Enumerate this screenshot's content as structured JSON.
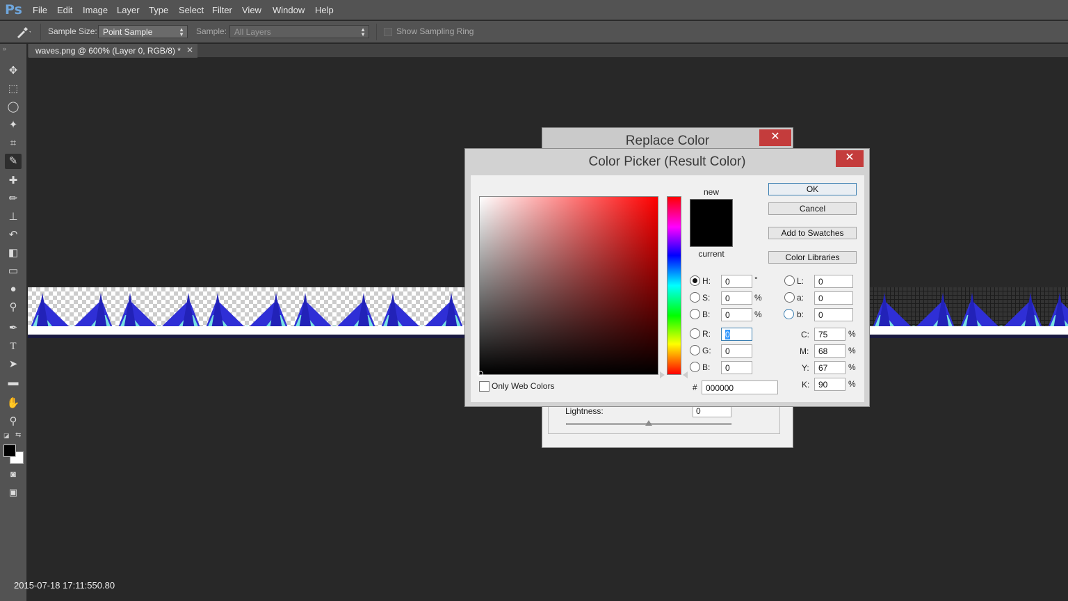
{
  "app": {
    "logo": "Ps"
  },
  "menu": [
    "File",
    "Edit",
    "Image",
    "Layer",
    "Type",
    "Select",
    "Filter",
    "View",
    "Window",
    "Help"
  ],
  "options": {
    "sample_size_label": "Sample Size:",
    "sample_size_value": "Point Sample",
    "sample_label": "Sample:",
    "sample_value": "All Layers",
    "sampling_ring_label": "Show Sampling Ring"
  },
  "document": {
    "tab_title": "waves.png @ 600% (Layer 0, RGB/8) *"
  },
  "replace_color": {
    "title": "Replace Color",
    "lightness_label": "Lightness:",
    "lightness_value": "0"
  },
  "color_picker": {
    "title": "Color Picker (Result Color)",
    "new_label": "new",
    "current_label": "current",
    "new_color": "#000000",
    "buttons": {
      "ok": "OK",
      "cancel": "Cancel",
      "add_to_swatches": "Add to Swatches",
      "color_libraries": "Color Libraries"
    },
    "fields": {
      "H": "0",
      "S": "0",
      "B": "0",
      "R": "0",
      "G": "0",
      "Bb": "0",
      "L": "0",
      "a": "0",
      "b": "0",
      "C": "75",
      "M": "68",
      "Y": "67",
      "K": "90"
    },
    "labels": {
      "H": "H:",
      "S": "S:",
      "B": "B:",
      "R": "R:",
      "G": "G:",
      "Bb": "B:",
      "L": "L:",
      "a": "a:",
      "b": "b:",
      "C": "C:",
      "M": "M:",
      "Y": "Y:",
      "K": "K:"
    },
    "units": {
      "deg": "°",
      "pct": "%"
    },
    "hex_label": "#",
    "hex_value": "000000",
    "only_web_colors": "Only Web Colors"
  },
  "timestamp": "2015-07-18 17:11:550.80",
  "colors": {
    "accent": "#3c7fb1",
    "close_red": "#c43c3c",
    "wave_blue": "#2f2fd6",
    "wave_cyan": "#7ff4e4"
  }
}
